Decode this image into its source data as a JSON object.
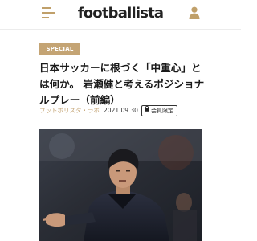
{
  "header": {
    "logo_text": "footballista",
    "menu_icon": "hamburger-menu-icon",
    "account_icon": "user-icon",
    "accent_color": "#c0a06a"
  },
  "article": {
    "badge_label": "SPECIAL",
    "badge_color": "#c4a474",
    "title": "日本サッカーに根づく「中重心」とは何か。 岩瀬健と考えるポジショナルプレー（前編）",
    "category": "フットボリスタ・ラボ",
    "date": "2021.09.30",
    "members_label": "会員限定",
    "members_icon": "lock-icon"
  }
}
